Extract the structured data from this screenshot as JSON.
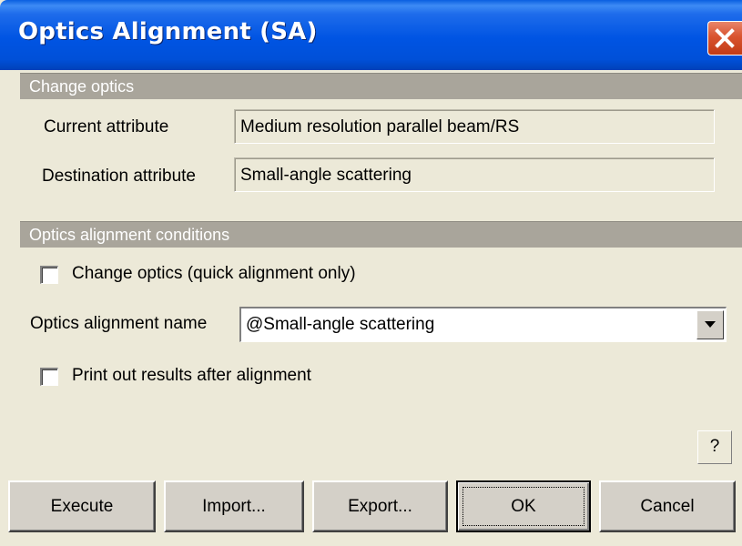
{
  "window": {
    "title": "Optics Alignment (SA)"
  },
  "change_optics": {
    "header": "Change optics",
    "current_label": "Current attribute",
    "current_value": "Medium resolution parallel beam/RS",
    "destination_label": "Destination attribute",
    "destination_value": "Small-angle scattering"
  },
  "conditions": {
    "header": "Optics alignment conditions",
    "change_optics_checkbox": {
      "label": "Change optics (quick alignment only)",
      "checked": false
    },
    "alignment_name_label": "Optics alignment name",
    "alignment_name_value": "@Small-angle scattering",
    "print_checkbox": {
      "label": "Print out results after alignment",
      "checked": false
    }
  },
  "help_label": "?",
  "buttons": {
    "execute": "Execute",
    "import": "Import...",
    "export": "Export...",
    "ok": "OK",
    "cancel": "Cancel"
  },
  "colors": {
    "titlebar": "#0054E3",
    "close": "#D9542F",
    "section_header": "#A9A59B",
    "dialog_bg": "#ECE9D8"
  },
  "icons": {
    "close": "close-icon",
    "combo": "chevron-down-icon"
  }
}
